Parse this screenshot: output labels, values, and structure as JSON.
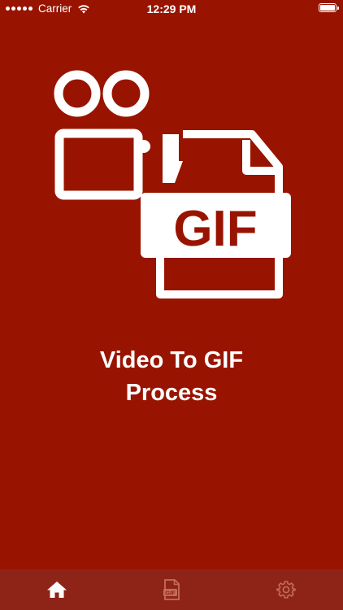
{
  "status_bar": {
    "carrier": "Carrier",
    "time": "12:29 PM",
    "icons": [
      "signal-dots-icon",
      "wifi-icon",
      "battery-icon"
    ]
  },
  "logo": {
    "icon": "video-to-gif-logo",
    "text": "GIF"
  },
  "main": {
    "title_line1": "Video To GIF",
    "title_line2": "Process"
  },
  "tab_bar": {
    "items": [
      {
        "icon": "home-icon",
        "active": true
      },
      {
        "icon": "gif-file-icon",
        "active": false,
        "badge_text": "GIF"
      },
      {
        "icon": "gear-icon",
        "active": false
      }
    ]
  },
  "colors": {
    "background": "#981400",
    "tab_bar": "#8e2418",
    "foreground": "#ffffff",
    "inactive_icon": "#c56c5c"
  }
}
